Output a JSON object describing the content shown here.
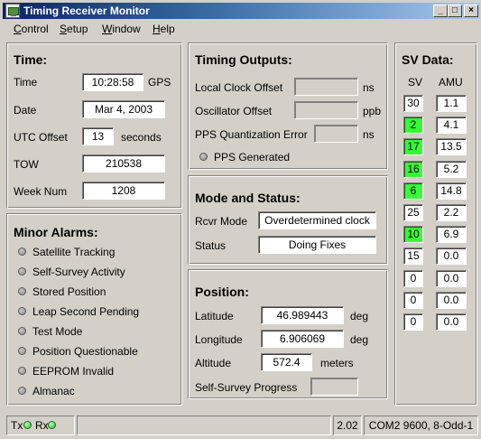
{
  "window": {
    "title": "Timing Receiver Monitor"
  },
  "menu": [
    "Control",
    "Setup",
    "Window",
    "Help"
  ],
  "time_panel": {
    "title": "Time:",
    "time_label": "Time",
    "time_value": "10:28:58",
    "time_unit": "GPS",
    "date_label": "Date",
    "date_value": "Mar 4, 2003",
    "utc_label": "UTC Offset",
    "utc_value": "13",
    "utc_unit": "seconds",
    "tow_label": "TOW",
    "tow_value": "210538",
    "week_label": "Week Num",
    "week_value": "1208"
  },
  "alarms_panel": {
    "title": "Minor Alarms:",
    "items": [
      "Satellite Tracking",
      "Self-Survey Activity",
      "Stored Position",
      "Leap Second Pending",
      "Test Mode",
      "Position Questionable",
      "EEPROM Invalid",
      "Almanac"
    ]
  },
  "timing_panel": {
    "title": "Timing Outputs:",
    "local_clock_label": "Local Clock Offset",
    "local_clock_value": "",
    "local_clock_unit": "ns",
    "osc_label": "Oscillator Offset",
    "osc_value": "",
    "osc_unit": "ppb",
    "pps_q_label": "PPS Quantization Error",
    "pps_q_value": "",
    "pps_q_unit": "ns",
    "pps_gen_label": "PPS Generated"
  },
  "mode_panel": {
    "title": "Mode and Status:",
    "rcvr_label": "Rcvr Mode",
    "rcvr_value": "Overdetermined clock",
    "status_label": "Status",
    "status_value": "Doing Fixes"
  },
  "position_panel": {
    "title": "Position:",
    "lat_label": "Latitude",
    "lat_value": "46.989443",
    "lat_unit": "deg",
    "lon_label": "Longitude",
    "lon_value": "6.906069",
    "lon_unit": "deg",
    "alt_label": "Altitude",
    "alt_value": "572.4",
    "alt_unit": "meters",
    "survey_label": "Self-Survey Progress",
    "survey_value": ""
  },
  "sv_panel": {
    "title": "SV Data:",
    "col_sv": "SV",
    "col_amu": "AMU",
    "rows": [
      {
        "sv": "30",
        "amu": "1.1",
        "tracked": false
      },
      {
        "sv": "2",
        "amu": "4.1",
        "tracked": true
      },
      {
        "sv": "17",
        "amu": "13.5",
        "tracked": true
      },
      {
        "sv": "16",
        "amu": "5.2",
        "tracked": true
      },
      {
        "sv": "6",
        "amu": "14.8",
        "tracked": true
      },
      {
        "sv": "25",
        "amu": "2.2",
        "tracked": false
      },
      {
        "sv": "10",
        "amu": "6.9",
        "tracked": true
      },
      {
        "sv": "15",
        "amu": "0.0",
        "tracked": false
      },
      {
        "sv": "0",
        "amu": "0.0",
        "tracked": false
      },
      {
        "sv": "0",
        "amu": "0.0",
        "tracked": false
      },
      {
        "sv": "0",
        "amu": "0.0",
        "tracked": false
      }
    ]
  },
  "statusbar": {
    "tx_label": "Tx",
    "rx_label": "Rx",
    "version": "2.02",
    "port": "COM2 9600, 8-Odd-1"
  },
  "colors": {
    "tracked": "#33ff33",
    "titlebar_start": "#0a246a",
    "titlebar_end": "#a6caf0",
    "led_on": "#20c020"
  }
}
